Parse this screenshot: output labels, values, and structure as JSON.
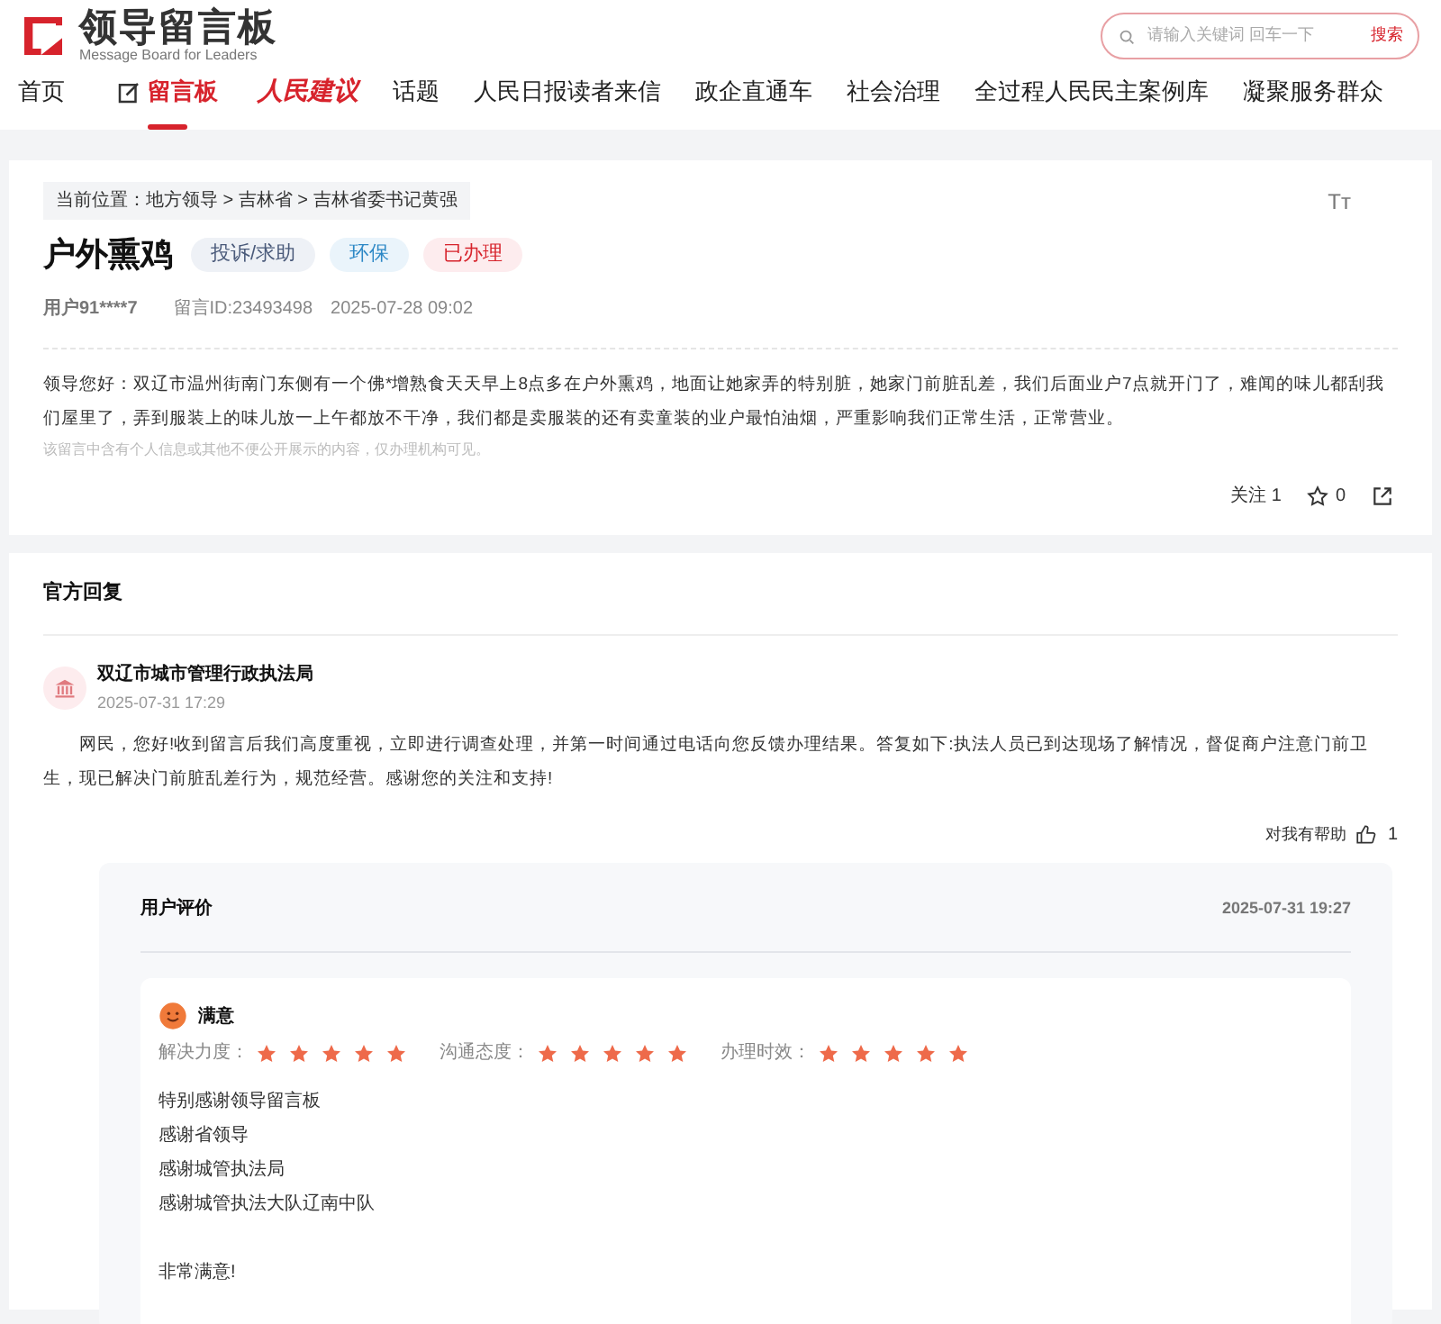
{
  "logo": {
    "title": "领导留言板",
    "subtitle": "Message Board for Leaders"
  },
  "search": {
    "placeholder": "请输入关键词 回车一下",
    "button": "搜索"
  },
  "nav": [
    {
      "label": "首页",
      "selected": false,
      "kind": "plain"
    },
    {
      "label": "留言板",
      "selected": true,
      "kind": "board"
    },
    {
      "label": "人民建议",
      "selected": false,
      "kind": "brand"
    },
    {
      "label": "话题",
      "selected": false,
      "kind": "plain"
    },
    {
      "label": "人民日报读者来信",
      "selected": false,
      "kind": "plain"
    },
    {
      "label": "政企直通车",
      "selected": false,
      "kind": "plain"
    },
    {
      "label": "社会治理",
      "selected": false,
      "kind": "plain"
    },
    {
      "label": "全过程人民民主案例库",
      "selected": false,
      "kind": "plain"
    },
    {
      "label": "凝聚服务群众",
      "selected": false,
      "kind": "plain"
    }
  ],
  "message": {
    "breadcrumb": "当前位置：地方领导 > 吉林省 > 吉林省委书记黄强",
    "font_toggle": "Tт",
    "title": "户外熏鸡",
    "tags": [
      {
        "label": "投诉/求助",
        "color": "#eef1f6"
      },
      {
        "label": "环保",
        "color": "#eaf4fb"
      },
      {
        "label": "已办理",
        "color": "#fdecee"
      }
    ],
    "user": "用户91****7",
    "message_id": "留言ID:23493498",
    "time": "2025-07-28 09:02",
    "body": "领导您好：双辽市温州街南门东侧有一个佛*增熟食天天早上8点多在户外熏鸡，地面让她家弄的特别脏，她家门前脏乱差，我们后面业户7点就开门了，难闻的味儿都刮我们屋里了，弄到服装上的味儿放一上午都放不干净，我们都是卖服装的还有卖童装的业户最怕油烟，严重影响我们正常生活，正常营业。",
    "notice": "该留言中含有个人信息或其他不便公开展示的内容，仅办理机构可见。",
    "follow": "关注 1",
    "favorites": "0"
  },
  "reply": {
    "heading": "官方回复",
    "agency": "双辽市城市管理行政执法局",
    "time": "2025-07-31 17:29",
    "body": "网民，您好!收到留言后我们高度重视，立即进行调查处理，并第一时间通过电话向您反馈办理结果。答复如下:执法人员已到达现场了解情况，督促商户注意门前卫生，现已解决门前脏乱差行为，规范经营。感谢您的关注和支持!",
    "helpful_label": "对我有帮助",
    "helpful_count": "1"
  },
  "evaluation": {
    "heading": "用户评价",
    "time": "2025-07-31 19:27",
    "verdict": "满意",
    "ratings": [
      {
        "label": "解决力度：",
        "stars": 5
      },
      {
        "label": "沟通态度：",
        "stars": 5
      },
      {
        "label": "办理时效：",
        "stars": 5
      }
    ],
    "lines": [
      "特别感谢领导留言板",
      "感谢省领导",
      "感谢城管执法局",
      "感谢城管执法大队辽南中队"
    ],
    "closing": "非常满意!"
  }
}
